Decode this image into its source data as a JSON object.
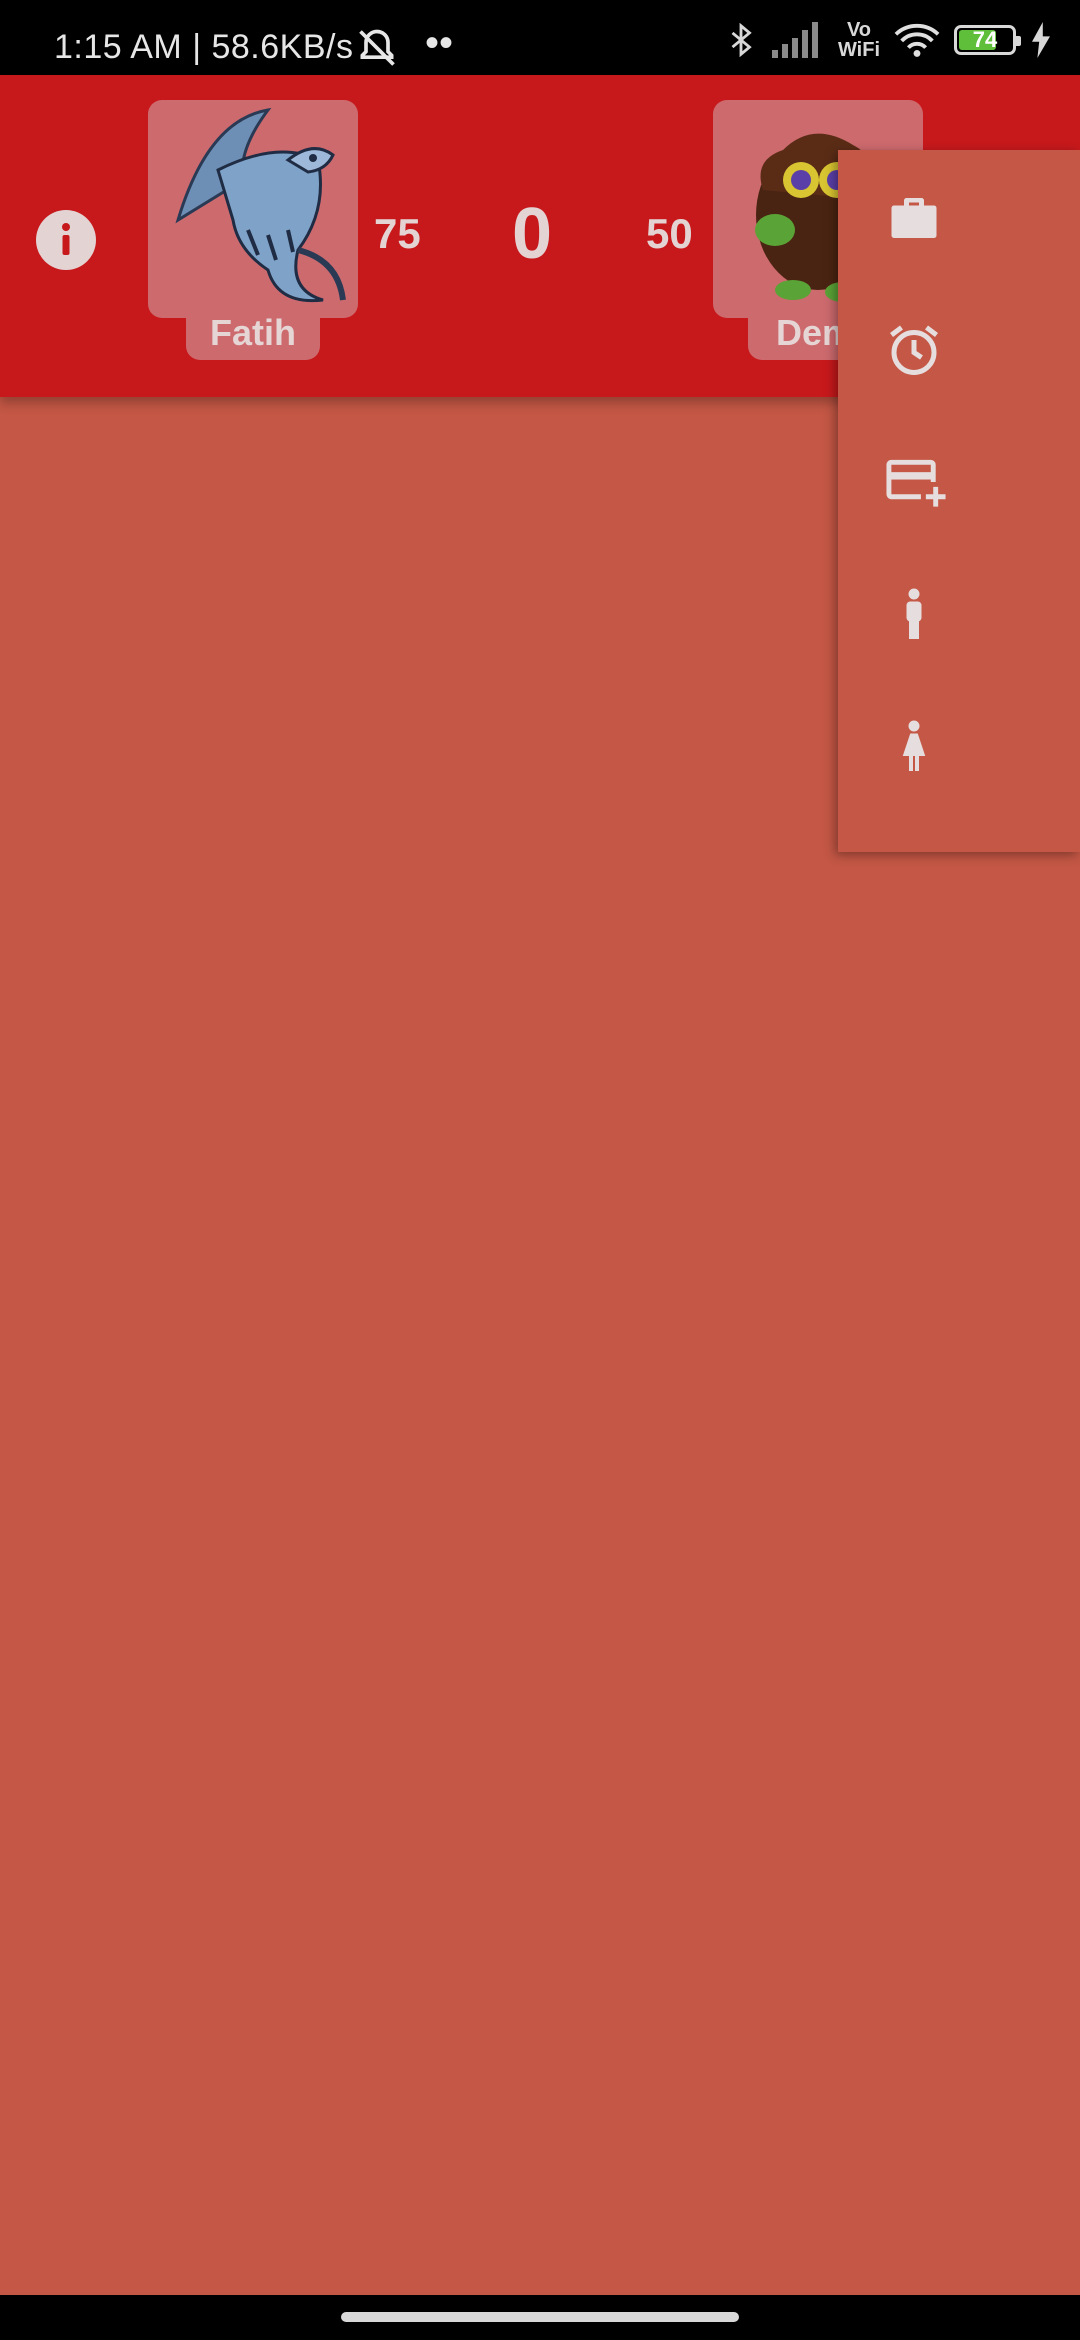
{
  "status_bar": {
    "time_speed": "1:15 AM | 58.6KB/s",
    "battery_level": "74",
    "battery_fraction": 0.74,
    "icons": [
      "mute-icon",
      "more-dots-icon",
      "bluetooth-icon",
      "signal-icon",
      "vowifi-icon",
      "wifi-icon",
      "battery-icon",
      "charging-icon"
    ],
    "vowifi_top": "Vo",
    "vowifi_bottom": "WiFi"
  },
  "header": {
    "info_icon": "info-icon",
    "player1": {
      "name": "Fatih",
      "side_score": "75",
      "avatar": "blue-dragon-avatar"
    },
    "center_score": "0",
    "player2": {
      "name": "Dem",
      "side_score": "50",
      "avatar": "furball-avatar"
    }
  },
  "popup_menu": {
    "items": [
      {
        "icon": "briefcase-icon"
      },
      {
        "icon": "alarm-clock-icon"
      },
      {
        "icon": "add-card-icon"
      },
      {
        "icon": "man-icon"
      },
      {
        "icon": "woman-icon"
      }
    ]
  },
  "colors": {
    "background": "#c45745",
    "appbar": "#c7191c",
    "avatar_card": "#cd6a6e",
    "text_light": "#e3d3d3"
  }
}
